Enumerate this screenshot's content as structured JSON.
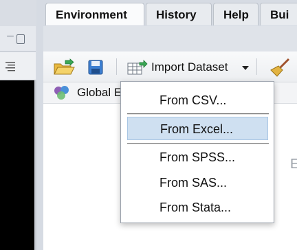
{
  "tabs": [
    {
      "label": "Environment",
      "active": true
    },
    {
      "label": "History",
      "active": false
    },
    {
      "label": "Help",
      "active": false
    },
    {
      "label": "Bui",
      "active": false
    }
  ],
  "toolbar": {
    "import_label": "Import Dataset",
    "open_icon": "folder-open-icon",
    "save_icon": "save-icon",
    "import_icon": "table-import-icon",
    "clear_icon": "broom-icon"
  },
  "env": {
    "scope_label": "Global E",
    "scope_icon": "r-environment-icon"
  },
  "menu": {
    "items": [
      {
        "label": "From CSV...",
        "highlighted": false
      },
      {
        "label": "From Excel...",
        "highlighted": true
      },
      {
        "label": "From SPSS...",
        "highlighted": false
      },
      {
        "label": "From SAS...",
        "highlighted": false
      },
      {
        "label": "From Stata...",
        "highlighted": false
      }
    ]
  },
  "background_text": "E",
  "colors": {
    "highlight": "#cfe0f1",
    "tab_active": "#fafbfc",
    "console": "#000000"
  }
}
